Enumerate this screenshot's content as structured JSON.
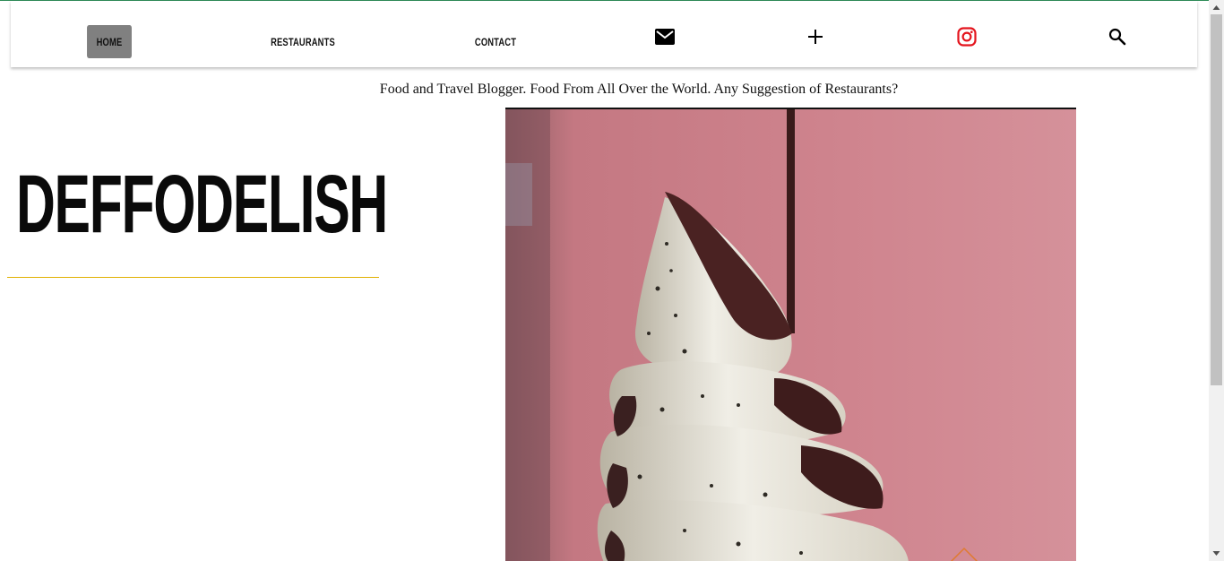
{
  "nav": {
    "home": "HOME",
    "restaurants": "RESTAURANTS",
    "contact": "CONTACT",
    "icons": [
      "mail-icon",
      "plus-icon",
      "instagram-icon",
      "search-icon"
    ]
  },
  "tagline": "Food and Travel Blogger. Food From All Over the World. Any Suggestion of Restaurants?",
  "brand": "DEFFODELISH",
  "hero": {
    "description": "soft serve ice cream cone with cookie crumbs and chocolate drizzle"
  },
  "colors": {
    "active_tab": "#808080",
    "brand_rule": "#e0b000",
    "instagram": "#e4151d",
    "hero_background": "#c97c86"
  }
}
